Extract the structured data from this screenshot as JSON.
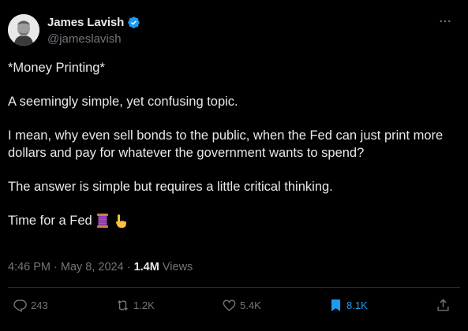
{
  "author": {
    "display_name": "James Lavish",
    "handle": "@jameslavish",
    "verified": true
  },
  "more_icon": "more-horizontal-icon",
  "tweet": {
    "paragraphs": [
      "*Money Printing*",
      "A seemingly simple, yet confusing topic.",
      "I mean, why even sell bonds to the public, when the Fed can just print more dollars and pay for whatever the government wants to spend?",
      "The answer is simple but requires a little critical thinking.",
      "Time for a Fed"
    ],
    "emojis": [
      "thread-spool-emoji",
      "pointing-down-emoji"
    ]
  },
  "meta": {
    "time": "4:46 PM",
    "date": "May 8, 2024",
    "views_count": "1.4M",
    "views_label": "Views"
  },
  "actions": {
    "replies": "243",
    "retweets": "1.2K",
    "likes": "5.4K",
    "bookmarks": "8.1K"
  },
  "colors": {
    "background": "#000000",
    "text": "#e7e9ea",
    "secondary": "#71767b",
    "accent": "#1d9bf0"
  }
}
